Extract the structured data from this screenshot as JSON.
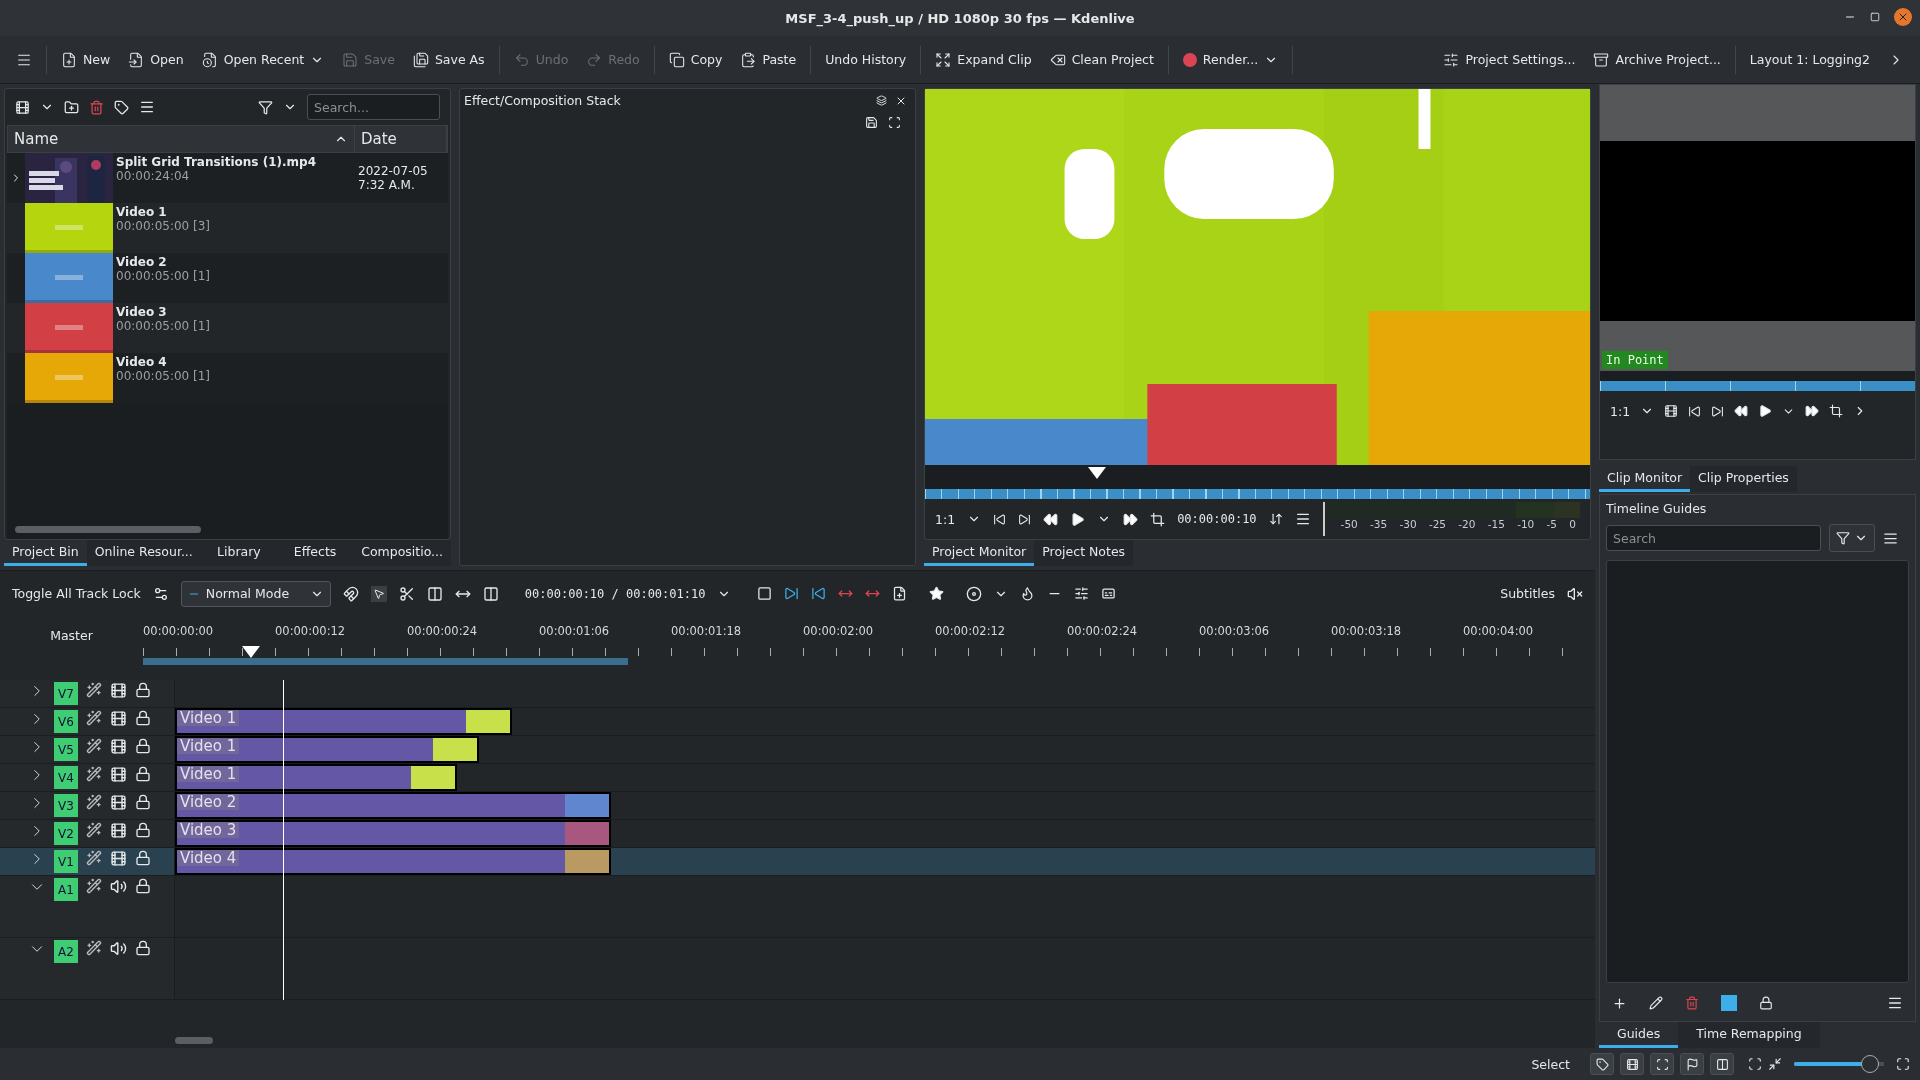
{
  "window": {
    "title": "MSF_3-4_push_up / HD 1080p 30 fps — Kdenlive"
  },
  "toolbar": [
    {
      "label": "New",
      "disabled": false,
      "dropdown": false
    },
    {
      "label": "Open",
      "disabled": false,
      "dropdown": false
    },
    {
      "label": "Open Recent",
      "disabled": false,
      "dropdown": true
    },
    {
      "label": "Save",
      "disabled": true,
      "dropdown": false
    },
    {
      "label": "Save As",
      "disabled": false,
      "dropdown": false
    },
    {
      "label": "Undo",
      "disabled": true,
      "dropdown": false
    },
    {
      "label": "Redo",
      "disabled": true,
      "dropdown": false
    },
    {
      "label": "Copy",
      "disabled": false,
      "dropdown": false
    },
    {
      "label": "Paste",
      "disabled": false,
      "dropdown": false
    },
    {
      "label": "Undo History",
      "disabled": false,
      "dropdown": false
    },
    {
      "label": "Expand Clip",
      "disabled": false,
      "dropdown": false
    },
    {
      "label": "Clean Project",
      "disabled": false,
      "dropdown": false
    },
    {
      "label": "Render...",
      "disabled": false,
      "dropdown": true
    },
    {
      "label": "Project Settings...",
      "disabled": false,
      "dropdown": false
    },
    {
      "label": "Archive Project...",
      "disabled": false,
      "dropdown": false
    },
    {
      "label": "Layout 1: Logging2",
      "disabled": false,
      "dropdown": false
    }
  ],
  "bin": {
    "search": {
      "placeholder": "Search..."
    },
    "columns": [
      "Name",
      "Date"
    ],
    "items": [
      {
        "name": "Split Grid Transitions (1).mp4",
        "duration": "00:00:24:04",
        "date": [
          "2022-07-05",
          "7:32 A.M."
        ],
        "expandable": true,
        "color": "#2a2440"
      },
      {
        "name": "Video 1",
        "duration": "00:00:05:00 [3]",
        "expandable": false,
        "color": "#b5d60f"
      },
      {
        "name": "Video 2",
        "duration": "00:00:05:00 [1]",
        "expandable": false,
        "color": "#4a88cc"
      },
      {
        "name": "Video 3",
        "duration": "00:00:05:00 [1]",
        "expandable": false,
        "color": "#d23f45"
      },
      {
        "name": "Video 4",
        "duration": "00:00:05:00 [1]",
        "expandable": false,
        "color": "#e5a807"
      }
    ],
    "tabs": [
      {
        "label": "Project Bin",
        "selected": true
      },
      {
        "label": "Online Resour...",
        "selected": false
      },
      {
        "label": "Library",
        "selected": false
      },
      {
        "label": "Effects",
        "selected": false
      },
      {
        "label": "Compositio...",
        "selected": false
      }
    ]
  },
  "effect_stack": {
    "title": "Effect/Composition Stack"
  },
  "project_monitor": {
    "zoom": "1:1",
    "timecode": "00:00:00:10",
    "meter_labels": [
      "-50",
      "-35",
      "-30",
      "-25",
      "-20",
      "-15",
      "-10",
      "-5",
      "0"
    ],
    "tabs": [
      {
        "label": "Project Monitor",
        "selected": true
      },
      {
        "label": "Project Notes",
        "selected": false
      }
    ]
  },
  "clip_monitor": {
    "marker": "In Point",
    "zoom": "1:1",
    "tabs": [
      {
        "label": "Clip Monitor",
        "selected": true
      },
      {
        "label": "Clip Properties",
        "selected": false
      }
    ]
  },
  "guides": {
    "title": "Timeline Guides",
    "search": {
      "placeholder": "Search"
    },
    "tabs": [
      {
        "label": "Guides",
        "selected": true
      },
      {
        "label": "Time Remapping",
        "selected": false
      }
    ]
  },
  "timeline": {
    "lock_label": "Toggle All Track Lock",
    "mode": "Normal Mode",
    "timecode": "00:00:00:10 / 00:00:01:10",
    "subtitles": "Subtitles",
    "master": "Master",
    "ruler": [
      "00:00:00:00",
      "00:00:00:12",
      "00:00:00:24",
      "00:00:01:06",
      "00:00:01:18",
      "00:00:02:00",
      "00:00:02:12",
      "00:00:02:24",
      "00:00:03:06",
      "00:00:03:18",
      "00:00:04:00"
    ],
    "tracks": [
      {
        "name": "V7",
        "kind": "video",
        "expanded": false,
        "selected": false
      },
      {
        "name": "V6",
        "kind": "video",
        "expanded": false,
        "selected": false,
        "clip": {
          "label": "Video 1",
          "color": "#c8e04a"
        }
      },
      {
        "name": "V5",
        "kind": "video",
        "expanded": false,
        "selected": false,
        "clip": {
          "label": "Video 1",
          "color": "#c8e04a"
        }
      },
      {
        "name": "V4",
        "kind": "video",
        "expanded": false,
        "selected": false,
        "clip": {
          "label": "Video 1",
          "color": "#c8e04a"
        }
      },
      {
        "name": "V3",
        "kind": "video",
        "expanded": false,
        "selected": false,
        "clip": {
          "label": "Video 2",
          "color": "#5f86cf"
        }
      },
      {
        "name": "V2",
        "kind": "video",
        "expanded": false,
        "selected": false,
        "clip": {
          "label": "Video 3",
          "color": "#a8577f"
        }
      },
      {
        "name": "V1",
        "kind": "video",
        "expanded": false,
        "selected": true,
        "clip": {
          "label": "Video 4",
          "color": "#b89a62"
        }
      },
      {
        "name": "A1",
        "kind": "audio",
        "expanded": true,
        "selected": false
      },
      {
        "name": "A2",
        "kind": "audio",
        "expanded": true,
        "selected": false
      }
    ]
  },
  "status": {
    "tool": "Select",
    "zoom": {
      "level": 0.93
    }
  }
}
